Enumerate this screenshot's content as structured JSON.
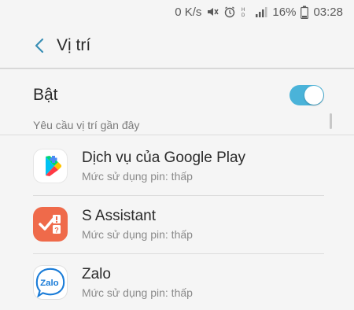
{
  "status_bar": {
    "data_speed": "0 K/s",
    "battery_percent": "16%",
    "time": "03:28",
    "icons": [
      "mute-icon",
      "alarm-icon",
      "hd-icon",
      "signal-icon",
      "battery-icon"
    ]
  },
  "header": {
    "title": "Vị trí"
  },
  "master": {
    "label": "Bật",
    "enabled": true,
    "accent_color": "#4ab3d9"
  },
  "section": {
    "title": "Yêu cầu vị trí gần đây"
  },
  "apps": [
    {
      "name": "Dịch vụ của Google Play",
      "usage": "Mức sử dụng pin: thấp",
      "icon": "google-play-services-icon"
    },
    {
      "name": "S Assistant",
      "usage": "Mức sử dụng pin: thấp",
      "icon": "s-assistant-icon",
      "icon_color": "#ef6a4a"
    },
    {
      "name": "Zalo",
      "usage": "Mức sử dụng pin: thấp",
      "icon": "zalo-icon",
      "icon_color": "#1a7cd8"
    }
  ]
}
